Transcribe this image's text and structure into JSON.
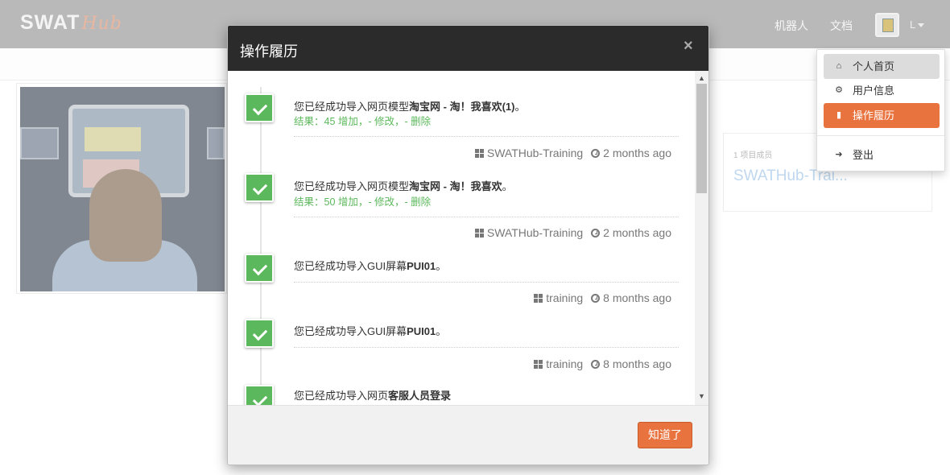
{
  "header": {
    "logo_main": "SWAT",
    "logo_sub": "Hub",
    "nav": [
      "机器人",
      "文档"
    ],
    "user_label": "L"
  },
  "project_card": {
    "members": "1 项目成员",
    "name": "SWATHub-Trai..."
  },
  "user_menu": {
    "items": [
      {
        "label": "个人首页",
        "icon": "home-icon"
      },
      {
        "label": "用户信息",
        "icon": "cogs-icon"
      },
      {
        "label": "操作履历",
        "icon": "book-icon",
        "active": true
      }
    ],
    "logout": {
      "label": "登出",
      "icon": "sign-out-icon"
    }
  },
  "modal": {
    "title": "操作履历",
    "close": "×",
    "ok_label": "知道了",
    "entries": [
      {
        "prefix": "您已经成功导入网页模型",
        "bold": "淘宝网 - 淘！我喜欢(1)",
        "suffix": "。",
        "result": "结果：45 增加，- 修改，- 删除",
        "project": "SWATHub-Training",
        "time": "2 months ago"
      },
      {
        "prefix": "您已经成功导入网页模型",
        "bold": "淘宝网 - 淘！我喜欢",
        "suffix": "。",
        "result": "结果：50 增加，- 修改，- 删除",
        "project": "SWATHub-Training",
        "time": "2 months ago"
      },
      {
        "prefix": "您已经成功导入GUI屏幕",
        "bold": "PUI01",
        "suffix": "。",
        "result": "",
        "project": "training",
        "time": "8 months ago"
      },
      {
        "prefix": "您已经成功导入GUI屏幕",
        "bold": "PUI01",
        "suffix": "。",
        "result": "",
        "project": "training",
        "time": "8 months ago"
      },
      {
        "prefix": "您已经成功导入网页",
        "bold": "客服人员登录",
        "suffix": "",
        "result": "",
        "project": "",
        "time": ""
      }
    ]
  },
  "colors": {
    "accent": "#e8733e",
    "success": "#5cb85c",
    "modal_header": "#2b2b2b",
    "topbar": "#b9b9b9"
  }
}
